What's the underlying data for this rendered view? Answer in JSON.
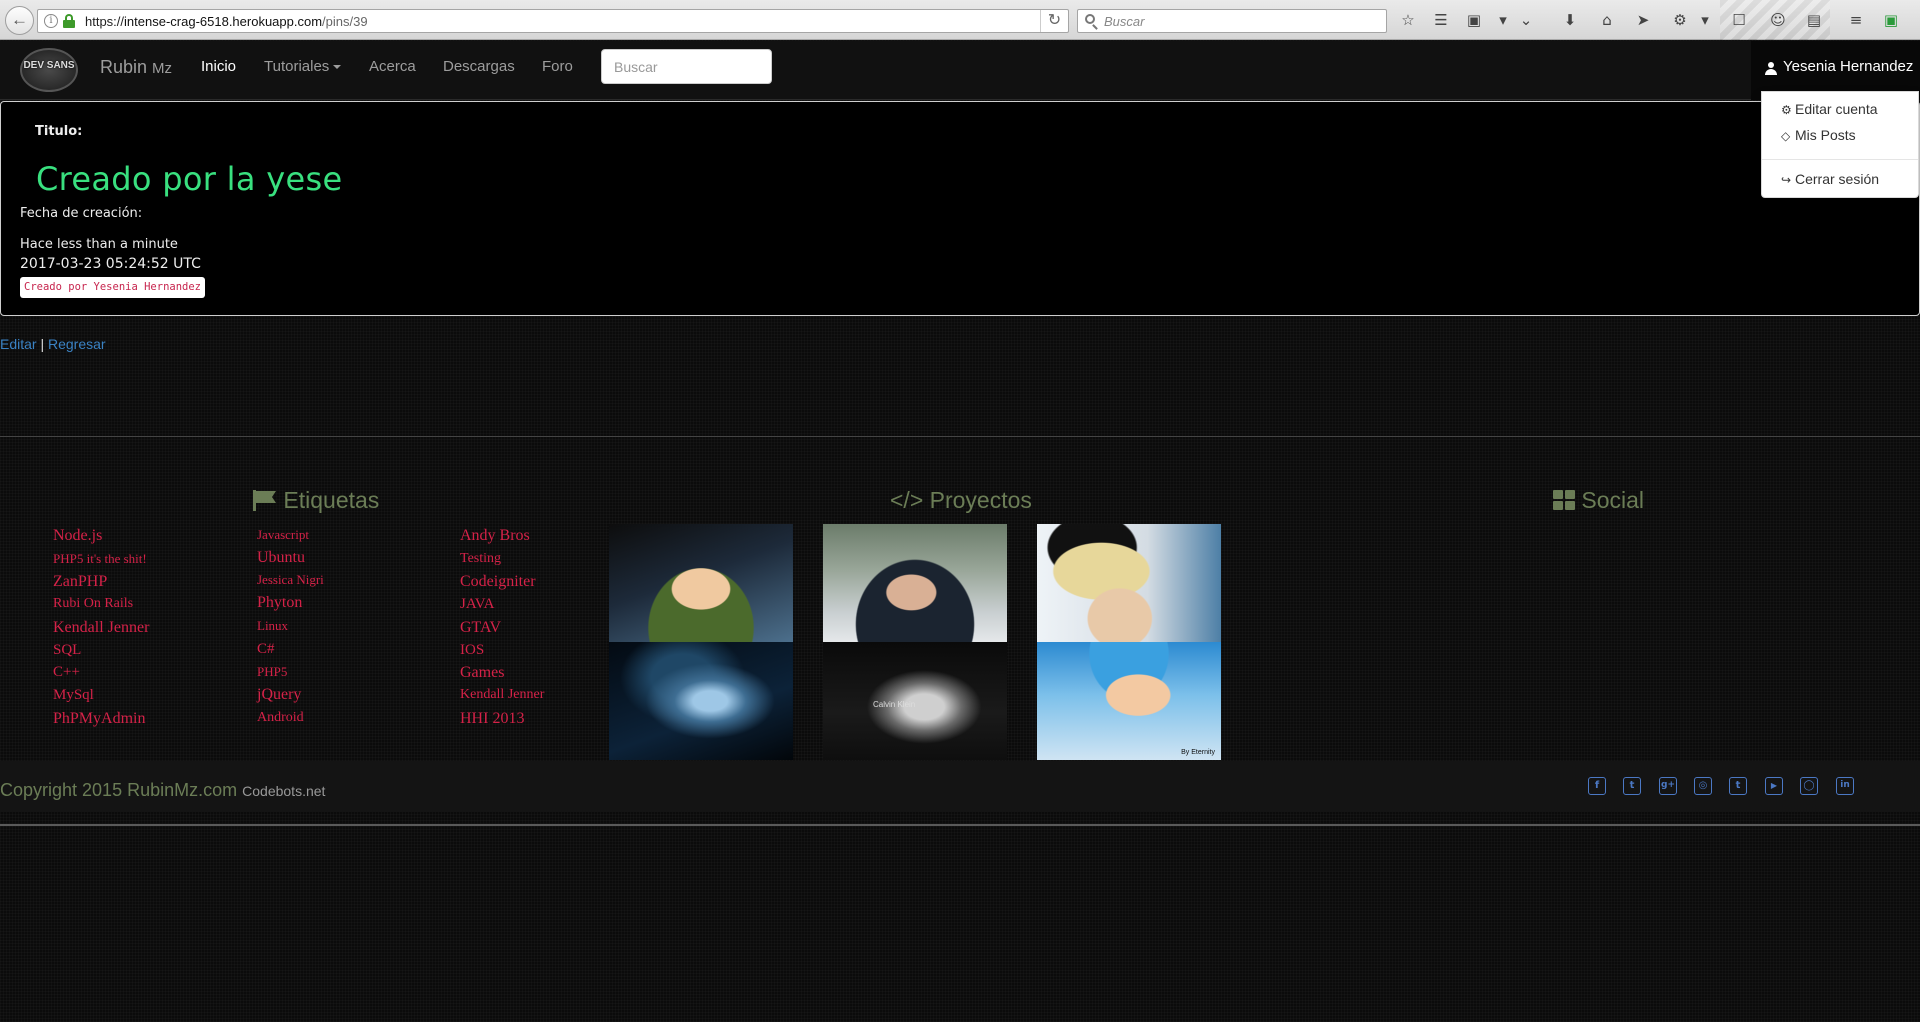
{
  "browser": {
    "url_scheme": "https://",
    "url_host": "intense-crag-6518.herokuapp.com",
    "url_path": "/pins/39",
    "search_placeholder": "Buscar"
  },
  "navbar": {
    "logo_text": "DEV SANS",
    "brand_name": "Rubin",
    "brand_suffix": "Mz",
    "links": [
      "Inicio",
      "Tutoriales",
      "Acerca",
      "Descargas",
      "Foro"
    ],
    "active_link": "Inicio",
    "search_placeholder": "Buscar",
    "user_name": "Yesenia Hernandez"
  },
  "user_dropdown": {
    "items": [
      "Editar cuenta",
      "Mis Posts",
      "Cerrar sesión"
    ]
  },
  "pin": {
    "title_label": "Titulo:",
    "title": "Creado por la yese",
    "date_label": "Fecha de creación:",
    "relative_time": "Hace less than a minute",
    "timestamp": "2017-03-23 05:24:52 UTC",
    "author_badge": "Creado por Yesenia Hernandez"
  },
  "actions": {
    "edit": "Editar",
    "separator": "|",
    "back": "Regresar"
  },
  "footer": {
    "tags_heading": "Etiquetas",
    "projects_heading": "</> Proyectos",
    "social_heading": "Social",
    "tags_col1": [
      "Node.js",
      "PHP5 it's the shit!",
      "ZanPHP",
      "Rubi On Rails",
      "Kendall Jenner",
      "SQL",
      "C++",
      "MySql",
      "PhPMyAdmin"
    ],
    "tags_col2": [
      "Javascript",
      "Ubuntu",
      "Jessica Nigri",
      "Phyton",
      "Linux",
      "C#",
      "PHP5",
      "jQuery",
      "Android"
    ],
    "tags_col3": [
      "Andy Bros",
      "Testing",
      "Codeigniter",
      "JAVA",
      "GTAV",
      "IOS",
      "Games",
      "Kendall Jenner",
      "HHI 2013"
    ],
    "project_images": [
      "vegeta-portrait",
      "girl-portrait",
      "upside-down-girl",
      "cloud-dark-art",
      "calvin-klein-ad",
      "vegeta-blue-art"
    ],
    "ck_text": "Calvin Klein",
    "by_text": "By Eternity",
    "copyright": "Copyright 2015 RubinMz.com",
    "codebots": "Codebots.net",
    "social_icons": [
      "facebook-icon",
      "twitter-icon",
      "google-plus-icon",
      "instagram-icon",
      "tumblr-icon",
      "youtube-icon",
      "github-icon",
      "linkedin-icon"
    ],
    "social_glyphs": [
      "f",
      "t",
      "g+",
      "◎",
      "t",
      "▶",
      "◯",
      "in"
    ]
  },
  "colors": {
    "accent_green": "#39e07f",
    "footer_olive": "#6b7d56",
    "tag_red": "#d52248",
    "link_blue": "#3b83c4"
  }
}
